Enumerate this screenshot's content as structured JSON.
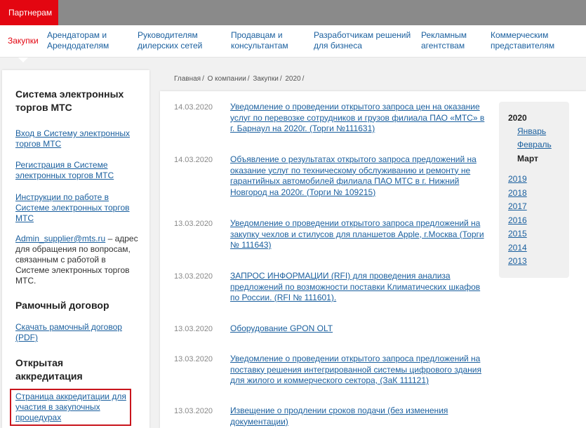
{
  "topbar": {
    "partners_label": "Партнерам"
  },
  "subnav": {
    "items": [
      "Закупки",
      "Арендаторам и Арендодателям",
      "Руководителям дилерских сетей",
      "Продавцам и консультантам",
      "Разработчикам решений для бизнеса",
      "Рекламным агентствам",
      "Коммерческим представителям"
    ]
  },
  "sidebar": {
    "section1_title": "Система электронных торгов МТС",
    "link_login": "Вход в Систему электронных торгов МТС",
    "link_register": "Регистрация в Системе электронных торгов МТС",
    "link_instructions": "Инструкции по работе в Системе электронных торгов МТС",
    "email": "Admin_supplier@mts.ru",
    "email_desc": "– адрес для обращения по вопросам, связанным с работой в Системе электронных торгов МТС.",
    "section2_title": "Рамочный договор",
    "link_download": "Скачать рамочный договор (PDF)",
    "section3_title": "Открытая аккредитация",
    "link_accreditation": "Страница аккредитации для участия в закупочных процедурах"
  },
  "breadcrumb": [
    "Главная",
    "О компании",
    "Закупки",
    "2020"
  ],
  "news": [
    {
      "date": "14.03.2020",
      "title": "Уведомление о проведении открытого запроса цен на оказание услуг по перевозке сотрудников и грузов филиала ПАО «МТС» в г. Барнаул на 2020г. (Торги №111631)"
    },
    {
      "date": "14.03.2020",
      "title": "Объявление о результатах открытого запроса предложений на оказание услуг по техническому обслуживанию и ремонту не гарантийных автомобилей филиала ПАО МТС в г. Нижний Новгород на 2020г. (Торги № 109215)"
    },
    {
      "date": "13.03.2020",
      "title": "Уведомление о проведении открытого запроса предложений на закупку чехлов и стилусов для планшетов Apple, г.Москва (Торги № 111643)"
    },
    {
      "date": "13.03.2020",
      "title": "ЗАПРОС ИНФОРМАЦИИ (RFI) для проведения анализа предложений по возможности поставки Климатических шкафов по России. (RFI № 111601)."
    },
    {
      "date": "13.03.2020",
      "title": "Оборудование GPON OLT"
    },
    {
      "date": "13.03.2020",
      "title": "Уведомление о проведении открытого запроса предложений на поставку решения интегрированной системы цифрового здания для жилого и коммерческого сектора, (ЗаК 111121)"
    },
    {
      "date": "13.03.2020",
      "title": "Извещение о продлении сроков подачи (без изменения документации)"
    }
  ],
  "archive": {
    "current_year": "2020",
    "months": [
      "Январь",
      "Февраль",
      "Март"
    ],
    "selected_month": "Март",
    "years": [
      "2019",
      "2018",
      "2017",
      "2016",
      "2015",
      "2014",
      "2013"
    ]
  },
  "colors": {
    "brand_red": "#e30611",
    "link_blue": "#1a5f9e",
    "topbar_gray": "#8a8a8a"
  }
}
